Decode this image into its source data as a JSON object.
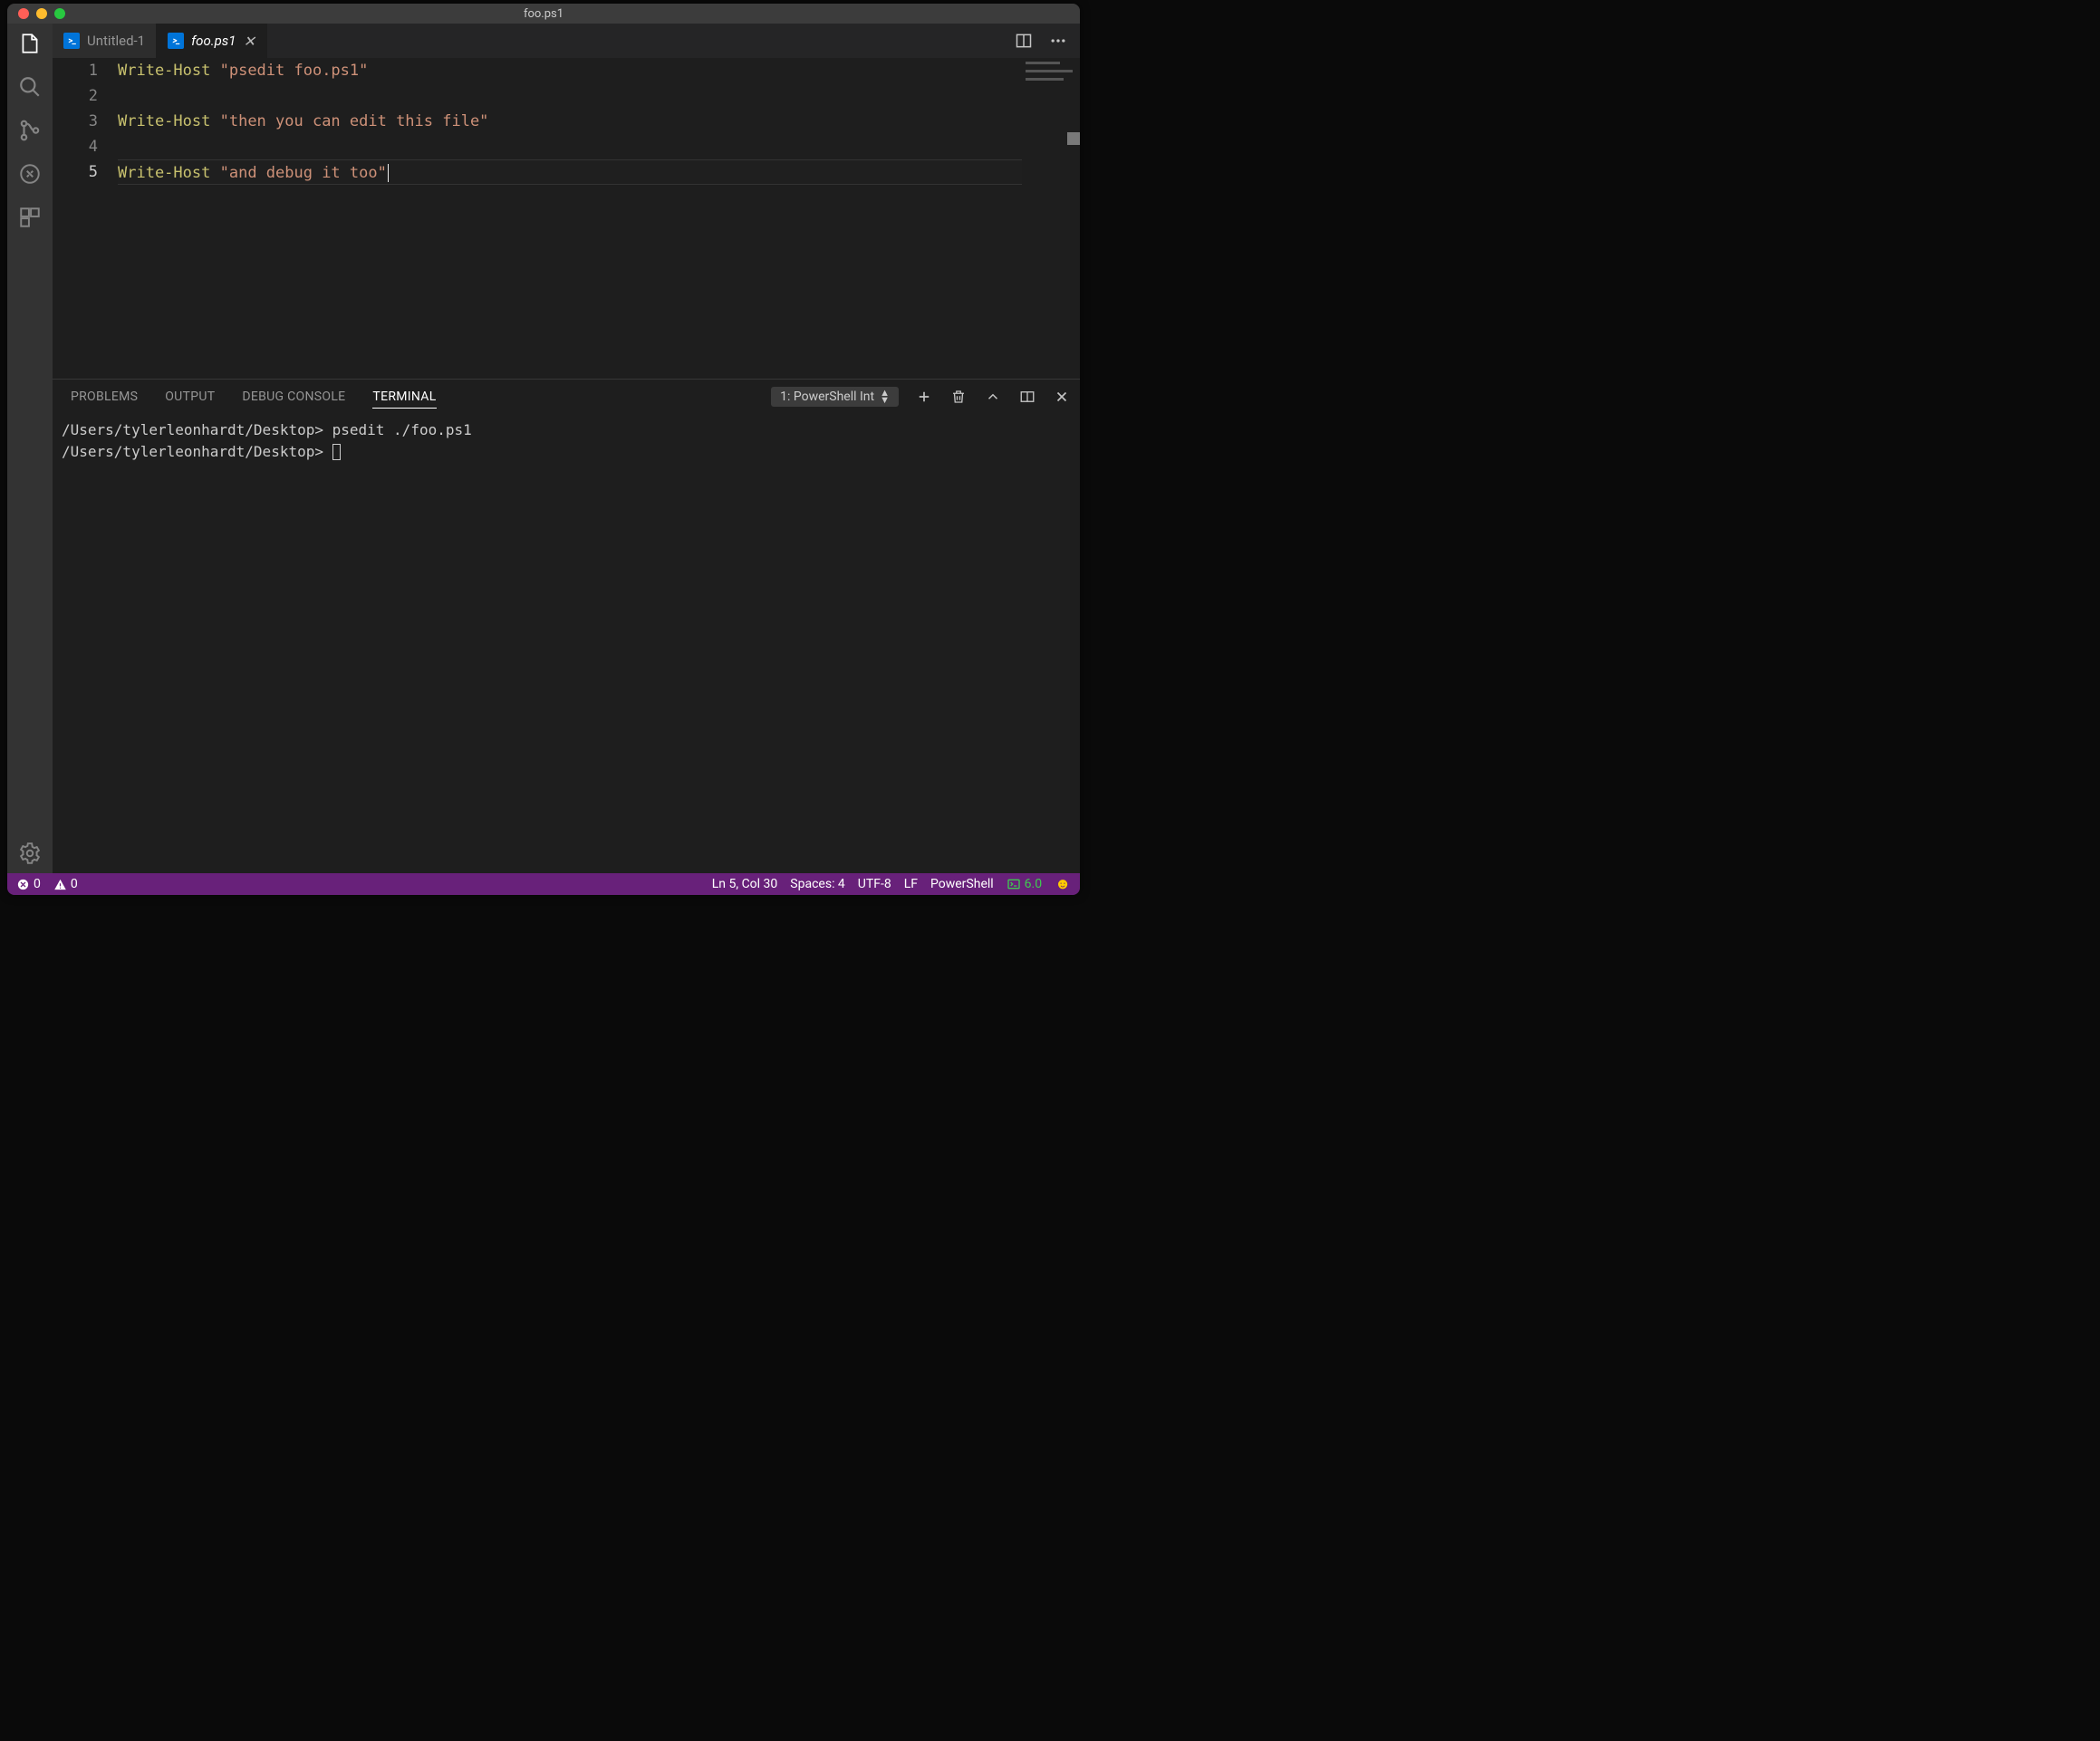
{
  "window": {
    "title": "foo.ps1"
  },
  "tabs": [
    {
      "label": "Untitled-1",
      "active": false
    },
    {
      "label": "foo.ps1",
      "active": true
    }
  ],
  "editor": {
    "lines": [
      {
        "n": 1,
        "cmd": "Write-Host",
        "str": "\"psedit foo.ps1\""
      },
      {
        "n": 2,
        "cmd": "",
        "str": ""
      },
      {
        "n": 3,
        "cmd": "Write-Host",
        "str": "\"then you can edit this file\""
      },
      {
        "n": 4,
        "cmd": "",
        "str": ""
      },
      {
        "n": 5,
        "cmd": "Write-Host",
        "str": "\"and debug it too\""
      }
    ],
    "currentLine": 5
  },
  "panel": {
    "tabs": [
      "PROBLEMS",
      "OUTPUT",
      "DEBUG CONSOLE",
      "TERMINAL"
    ],
    "activeTab": "TERMINAL",
    "terminalSelector": "1: PowerShell Int",
    "terminalLines": [
      "/Users/tylerleonhardt/Desktop> psedit ./foo.ps1",
      "/Users/tylerleonhardt/Desktop>"
    ]
  },
  "status": {
    "errors": "0",
    "warnings": "0",
    "lncol": "Ln 5, Col 30",
    "spaces": "Spaces: 4",
    "encoding": "UTF-8",
    "eol": "LF",
    "language": "PowerShell",
    "psver": "6.0"
  }
}
